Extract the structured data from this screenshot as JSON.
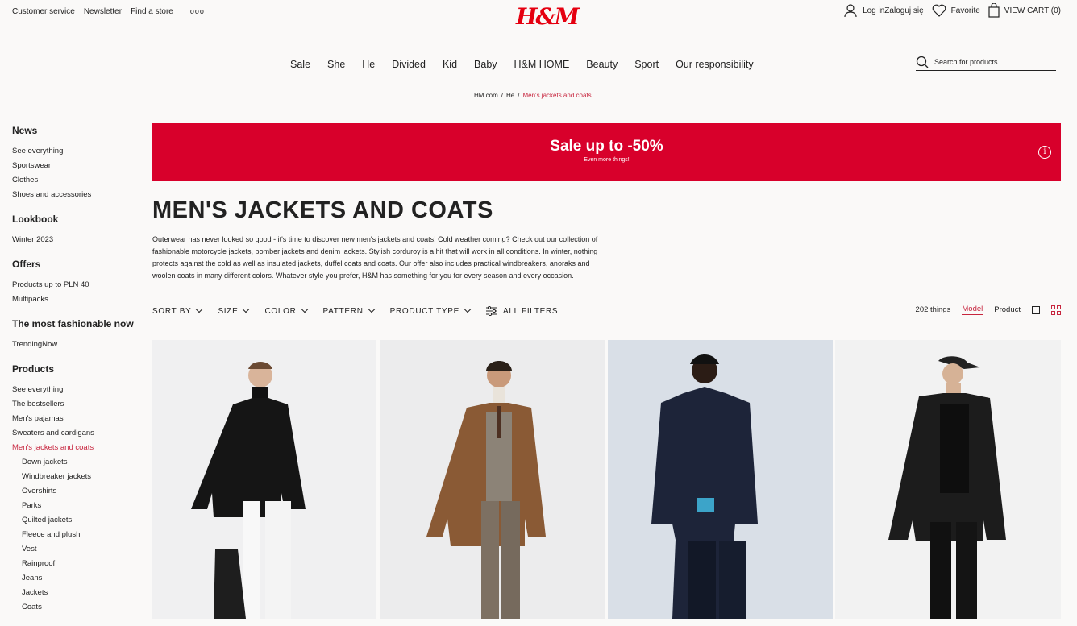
{
  "topbar": {
    "links": [
      "Customer service",
      "Newsletter",
      "Find a store"
    ],
    "more": "ooo",
    "logo": "H&M",
    "login": "Log inZaloguj się",
    "favorite": "Favorite",
    "cart": "VIEW CART (0)"
  },
  "nav": [
    "Sale",
    "She",
    "He",
    "Divided",
    "Kid",
    "Baby",
    "H&M HOME",
    "Beauty",
    "Sport",
    "Our responsibility"
  ],
  "search": {
    "placeholder": "Search for products"
  },
  "breadcrumb": [
    "HM.com",
    "/",
    "He",
    "/",
    "Men's jackets and coats"
  ],
  "sidebar": {
    "news": {
      "title": "News",
      "links": [
        "See everything",
        "Sportswear",
        "Clothes",
        "Shoes and accessories"
      ]
    },
    "lookbook": {
      "title": "Lookbook",
      "links": [
        "Winter 2023"
      ]
    },
    "offers": {
      "title": "Offers",
      "links": [
        "Products up to PLN 40",
        "Multipacks"
      ]
    },
    "fashionable": {
      "title": "The most fashionable now",
      "links": [
        "TrendingNow"
      ]
    },
    "products": {
      "title": "Products",
      "links": [
        "See everything",
        "The bestsellers",
        "Men's pajamas",
        "Sweaters and cardigans",
        "Men's jackets and coats"
      ],
      "sub": [
        "Down jackets",
        "Windbreaker jackets",
        "Overshirts",
        "Parks",
        "Quilted jackets",
        "Fleece and plush",
        "Vest",
        "Rainproof",
        "Jeans",
        "Jackets",
        "Coats"
      ]
    }
  },
  "banner": {
    "title": "Sale up to -50%",
    "sub": "Even more things!",
    "info": "i"
  },
  "page": {
    "title": "MEN'S JACKETS AND COATS",
    "description": "Outerwear has never looked so good - it's time to discover new men's jackets and coats! Cold weather coming? Check out our collection of fashionable motorcycle jackets, bomber jackets and denim jackets. Stylish corduroy is a hit that will work in all conditions. In winter, nothing protects against the cold as well as insulated jackets, duffel coats and coats. Our offer also includes practical windbreakers, anoraks and woolen coats in many different colors. Whatever style you prefer, H&M has something for you for every season and every occasion."
  },
  "filters": [
    "SORT BY",
    "SIZE",
    "COLOR",
    "PATTERN",
    "PRODUCT TYPE"
  ],
  "all_filters": "ALL FILTERS",
  "results": {
    "count": "202 things",
    "model": "Model",
    "product": "Product"
  }
}
